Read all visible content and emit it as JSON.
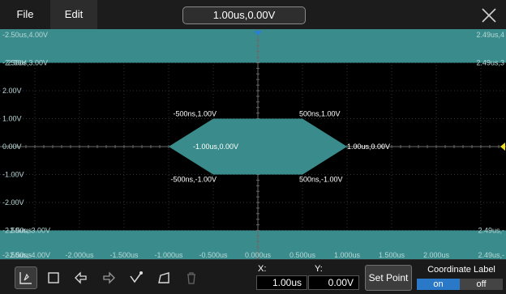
{
  "menu": {
    "file": "File",
    "edit": "Edit"
  },
  "readout": "1.00us,0.00V",
  "colors": {
    "band": "#3a8c8c",
    "mask": "#3a8c8c",
    "grid": "#333333",
    "axis": "#6a6a6a",
    "label": "#b8d7d7",
    "trigger": "#2a7fd4",
    "level": "#f0e020"
  },
  "left_labels": [
    {
      "text": "-2.50us,4.00V",
      "volts": 4
    },
    {
      "text": "-2.50us,3.00V",
      "volts": 3
    },
    {
      "text": "2.00V",
      "volts": 2
    },
    {
      "text": "1.00V",
      "volts": 1
    },
    {
      "text": "0.00V",
      "volts": 0
    },
    {
      "text": "-1.00V",
      "volts": -1
    },
    {
      "text": "-2.00V",
      "volts": -2
    },
    {
      "text": "-2.50us,-3.00V",
      "volts": -3
    },
    {
      "text": "-2.50us,-4.00V",
      "volts": -4
    }
  ],
  "left_overlays": [
    {
      "text": "2.00V",
      "volts": 3
    },
    {
      "text": "-2.50us",
      "volts": -3
    },
    {
      "text": "-2.50us",
      "volts": -4
    }
  ],
  "right_labels": [
    {
      "text": "2.49us,4",
      "volts": 4
    },
    {
      "text": "2.49us,3",
      "volts": 3
    },
    {
      "text": "2.49us,-",
      "volts": -3
    },
    {
      "text": "2.49us,-",
      "volts": -4
    }
  ],
  "time_labels": [
    {
      "text": "-2.000us",
      "us": -2.0
    },
    {
      "text": "-1.500us",
      "us": -1.5
    },
    {
      "text": "-1.000us",
      "us": -1.0
    },
    {
      "text": "-0.500us",
      "us": -0.5
    },
    {
      "text": "0.000us",
      "us": 0.0
    },
    {
      "text": "0.500us",
      "us": 0.5
    },
    {
      "text": "1.000us",
      "us": 1.0
    },
    {
      "text": "1.500us",
      "us": 1.5
    },
    {
      "text": "2.000us",
      "us": 2.0
    }
  ],
  "top_band": {
    "from_volts": 3,
    "to_volts": 4.4
  },
  "bottom_band": {
    "from_volts": -3,
    "to_volts": -4.4
  },
  "mask_points": [
    {
      "label": "-1.00us,0.00V",
      "us": -1.0,
      "volts": 0
    },
    {
      "label": "-500ns,1.00V",
      "us": -0.5,
      "volts": 1
    },
    {
      "label": "500ns,1.00V",
      "us": 0.5,
      "volts": 1
    },
    {
      "label": "1.00us,0.00V",
      "us": 1.0,
      "volts": 0
    },
    {
      "label": "500ns,-1.00V",
      "us": 0.5,
      "volts": -1
    },
    {
      "label": "-500ns,-1.00V",
      "us": -0.5,
      "volts": -1
    }
  ],
  "toolbar": {
    "x_label": "X:",
    "x_value": "1.00us",
    "y_label": "Y:",
    "y_value": "0.00V",
    "set_point": "Set Point",
    "coord_title": "Coordinate Label",
    "toggle_on": "on",
    "toggle_off": "off"
  }
}
